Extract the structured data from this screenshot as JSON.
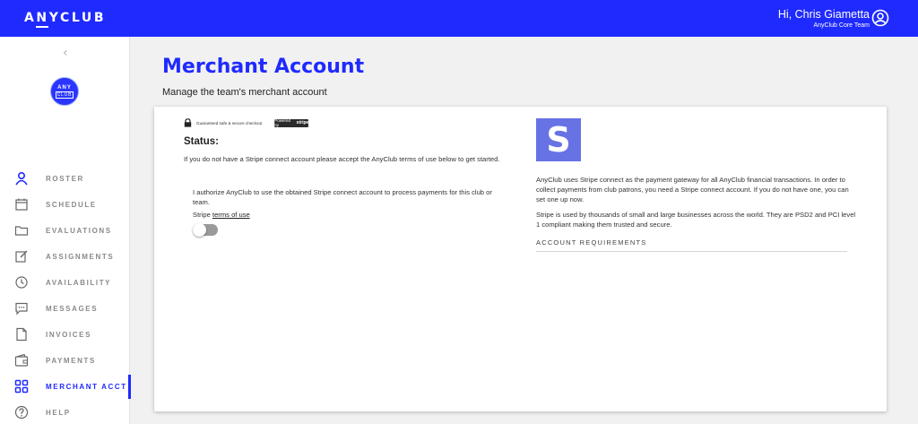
{
  "app": {
    "logo_text": "ANYCLUB"
  },
  "user": {
    "greeting": "Hi, Chris Giametta",
    "team": "AnyClub Core Team",
    "icon": "user-circle-icon"
  },
  "sidebar": {
    "collapse_icon": "chevron-left-icon",
    "club_avatar": {
      "line1": "ANY",
      "line2": "CLUB"
    },
    "items": [
      {
        "label": "ROSTER",
        "icon": "person-icon"
      },
      {
        "label": "SCHEDULE",
        "icon": "calendar-icon"
      },
      {
        "label": "EVALUATIONS",
        "icon": "folder-icon"
      },
      {
        "label": "ASSIGNMENTS",
        "icon": "edit-icon"
      },
      {
        "label": "AVAILABILITY",
        "icon": "clock-icon"
      },
      {
        "label": "MESSAGES",
        "icon": "chat-icon"
      },
      {
        "label": "INVOICES",
        "icon": "document-icon"
      },
      {
        "label": "PAYMENTS",
        "icon": "wallet-icon"
      },
      {
        "label": "MERCHANT ACCT",
        "icon": "grid-icon",
        "active": true
      },
      {
        "label": "HELP",
        "icon": "help-icon"
      }
    ]
  },
  "main": {
    "title": "Merchant Account",
    "subtitle": "Manage the team's merchant account"
  },
  "card": {
    "secure_checkout": "Guaranteed safe & secure checkout",
    "powered_by": "Powered by",
    "stripe_badge": "stripe",
    "status_label": "Status:",
    "status_text": "If you do not have a Stripe connect account please accept the AnyClub terms of use below to get started.",
    "authorize_text": "I authorize AnyClub to use the obtained Stripe connect account to process payments for this club or team.",
    "terms_prefix": "Stripe",
    "terms_link": "terms of use",
    "toggle_on": false,
    "stripe_logo_letter": "S",
    "stripe_color": "#6772e5",
    "info_paragraph_1": "AnyClub uses Stripe connect as the payment gateway for all AnyClub financial transactions. In order to collect payments from club patrons, you need a Stripe connect account. If you do not have one, you can set one up now.",
    "info_paragraph_2": "Stripe is used by thousands of small and large businesses across the world. They are PSD2 and PCI level 1 compliant making them trusted and secure.",
    "requirements_header": "ACCOUNT REQUIREMENTS"
  },
  "colors": {
    "brand": "#1f2aff",
    "toggle_off": "#9a9a9a"
  }
}
